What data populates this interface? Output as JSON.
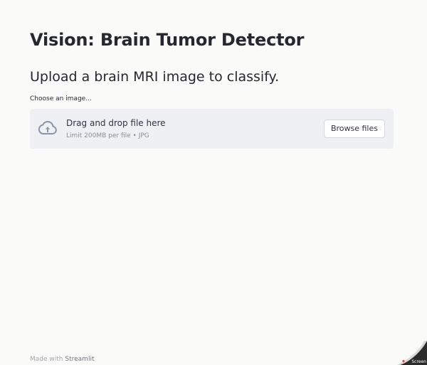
{
  "header": {
    "title": "Vision: Brain Tumor Detector",
    "subtitle": "Upload a brain MRI image to classify."
  },
  "uploader": {
    "label": "Choose an image...",
    "drop_title": "Drag and drop file here",
    "limit_text": "Limit 200MB per file • JPG",
    "browse_label": "Browse files",
    "icon": "cloud-upload-icon"
  },
  "footer": {
    "prefix": "Made with",
    "brand": "Streamlit"
  },
  "overlay": {
    "corner_text": "Screen"
  },
  "colors": {
    "background": "#fafbf9",
    "dropzone": "#eef0f4",
    "text": "#262730",
    "icon": "#8a96ab"
  }
}
